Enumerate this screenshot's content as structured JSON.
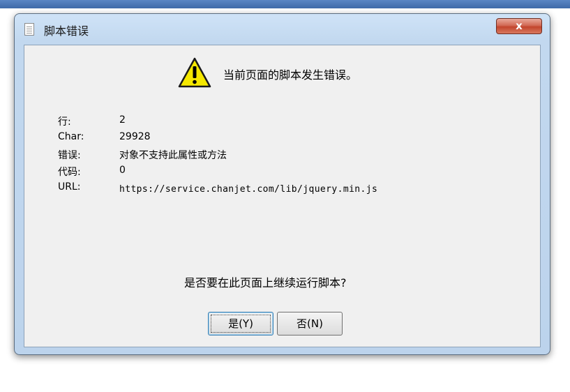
{
  "dialog": {
    "title": "脚本错误",
    "close_label": "x",
    "message": "当前页面的脚本发生错误。",
    "details": [
      {
        "label": "行:",
        "value": "2"
      },
      {
        "label": "Char:",
        "value": "29928"
      },
      {
        "label": "错误:",
        "value": "对象不支持此属性或方法"
      },
      {
        "label": "代码:",
        "value": "0"
      },
      {
        "label": "URL:",
        "value": "https://service.chanjet.com/lib/jquery.min.js"
      }
    ],
    "question": "是否要在此页面上继续运行脚本?",
    "yes_label": "是(Y)",
    "no_label": "否(N)"
  },
  "icons": {
    "title": "document-icon",
    "warning": "warning-icon"
  },
  "colors": {
    "warning_fill": "#f5e800",
    "close_button": "#c9503a",
    "titlebar": "#c2d8ef"
  }
}
